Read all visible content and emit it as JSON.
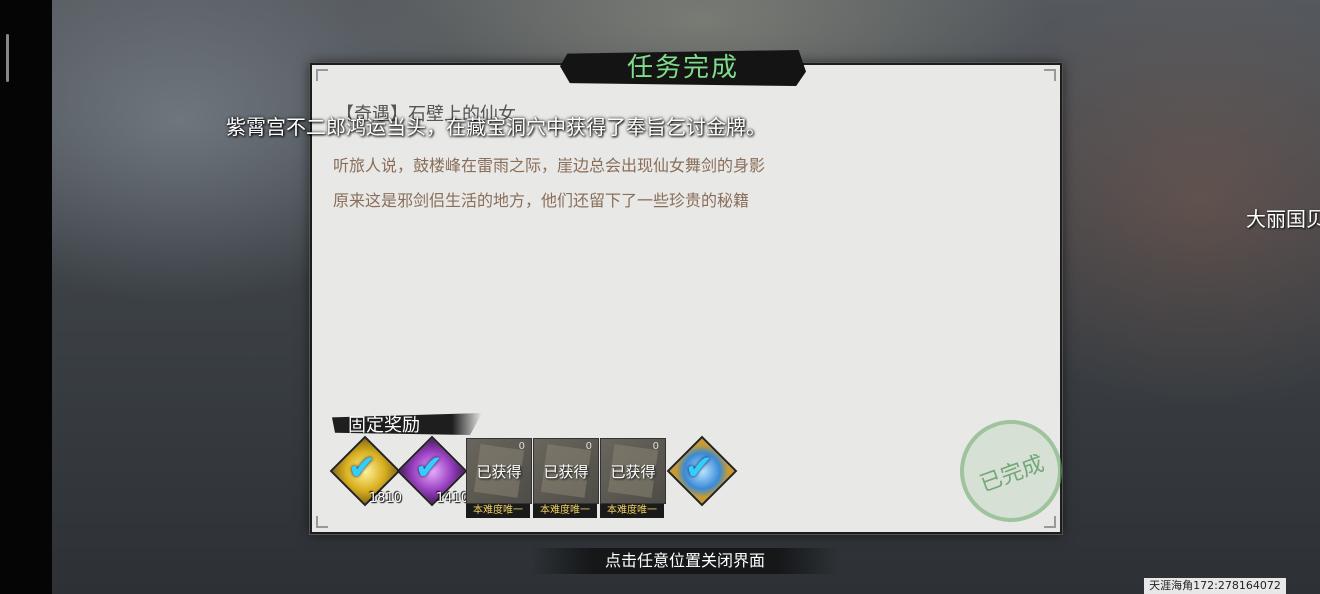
{
  "dialog": {
    "title": "任务完成",
    "quest_name": "【奇遇】石壁上的仙女",
    "description": [
      "听旅人说，鼓楼峰在雷雨之际，崖边总会出现仙女舞剑的身影",
      "原来这是邪剑侣生活的地方，他们还留下了一些珍贵的秘籍"
    ],
    "completed_stamp": "已完成"
  },
  "broadcast": {
    "message": "紫霄宫不二郎鸿运当头，在藏宝洞穴中获得了奉旨乞讨金牌。",
    "side_text": "大丽国贝"
  },
  "rewards": {
    "section_label": "固定奖励",
    "items": [
      {
        "type": "gold-badge",
        "count": "1810",
        "claimed": true
      },
      {
        "type": "purple-badge",
        "count": "1410",
        "claimed": true
      },
      {
        "type": "scroll",
        "status": "已获得",
        "tag": "本难度唯一",
        "corner_count": "0"
      },
      {
        "type": "scroll",
        "status": "已获得",
        "tag": "本难度唯一",
        "corner_count": "0"
      },
      {
        "type": "scroll",
        "status": "已获得",
        "tag": "本难度唯一",
        "corner_count": "0"
      },
      {
        "type": "blue-badge",
        "claimed": true
      }
    ]
  },
  "close_hint": "点击任意位置关闭界面",
  "footer": {
    "player_id": "天涯海角172:278164072"
  },
  "colors": {
    "title_green": "#7fdc8a",
    "description_brown": "#8a6e5a",
    "check_cyan": "#2ed0ff",
    "tag_gold": "#f0d060"
  }
}
